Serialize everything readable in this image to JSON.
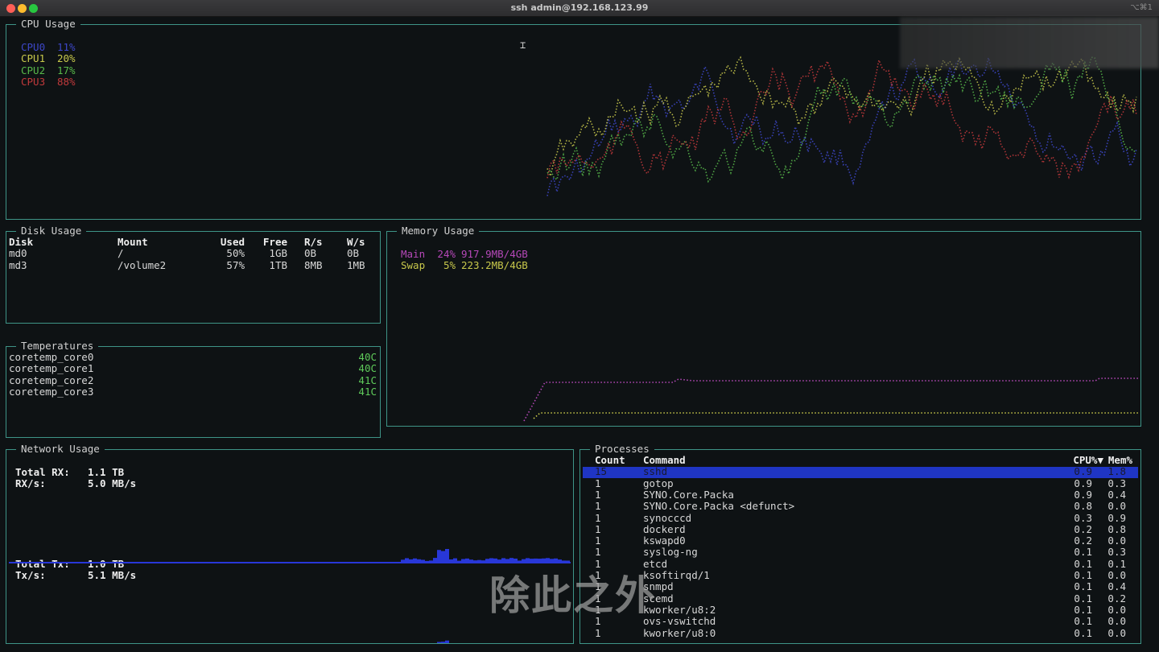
{
  "window": {
    "title": "ssh admin@192.168.123.99",
    "shortcut": "⌥⌘1"
  },
  "colors": {
    "border": "#3e9487",
    "cpu0": "#3d47c8",
    "cpu1": "#c8c84b",
    "cpu2": "#58b84a",
    "cpu3": "#c0393b",
    "mem_main": "#b548b8",
    "mem_swap": "#c8c84b",
    "temp": "#5ec95a",
    "net": "#2837d8",
    "selected": "#1f35c4"
  },
  "cpu": {
    "title": "CPU Usage",
    "legend": [
      {
        "name": "CPU0",
        "value": "11%"
      },
      {
        "name": "CPU1",
        "value": "20%"
      },
      {
        "name": "CPU2",
        "value": "17%"
      },
      {
        "name": "CPU3",
        "value": "88%"
      }
    ]
  },
  "disk": {
    "title": "Disk Usage",
    "headers": [
      "Disk",
      "Mount",
      "Used",
      "Free",
      "R/s",
      "W/s"
    ],
    "rows": [
      [
        "md0",
        "/",
        "50%",
        "1GB",
        "0B",
        "0B"
      ],
      [
        "md3",
        "/volume2",
        "57%",
        "1TB",
        "8MB",
        "1MB"
      ]
    ]
  },
  "memory": {
    "title": "Memory Usage",
    "rows": [
      {
        "label": "Main",
        "percent": "24%",
        "detail": "917.9MB/4GB"
      },
      {
        "label": "Swap",
        "percent": "5%",
        "detail": "223.2MB/4GB"
      }
    ]
  },
  "temps": {
    "title": "Temperatures",
    "rows": [
      {
        "name": "coretemp_core0",
        "value": "40C"
      },
      {
        "name": "coretemp_core1",
        "value": "40C"
      },
      {
        "name": "coretemp_core2",
        "value": "41C"
      },
      {
        "name": "coretemp_core3",
        "value": "41C"
      }
    ]
  },
  "network": {
    "title": "Network Usage",
    "rx": {
      "total_label": "Total RX:",
      "total": "1.1 TB",
      "rate_label": "RX/s:",
      "rate": "5.0 MB/s"
    },
    "tx": {
      "total_label": "Total Tx:",
      "total": "1.0 TB",
      "rate_label": "Tx/s:",
      "rate": "5.1 MB/s"
    }
  },
  "processes": {
    "title": "Processes",
    "headers": {
      "count": "Count",
      "command": "Command",
      "cpu": "CPU%▼",
      "mem": "Mem%"
    },
    "rows": [
      [
        "15",
        "sshd",
        "0.9",
        "1.8"
      ],
      [
        "1",
        "gotop",
        "0.9",
        "0.3"
      ],
      [
        "1",
        "SYNO.Core.Packa",
        "0.9",
        "0.4"
      ],
      [
        "1",
        "SYNO.Core.Packa <defunct>",
        "0.8",
        "0.0"
      ],
      [
        "1",
        "synocccd",
        "0.3",
        "0.9"
      ],
      [
        "1",
        "dockerd",
        "0.2",
        "0.8"
      ],
      [
        "1",
        "kswapd0",
        "0.2",
        "0.0"
      ],
      [
        "1",
        "syslog-ng",
        "0.1",
        "0.3"
      ],
      [
        "1",
        "etcd",
        "0.1",
        "0.1"
      ],
      [
        "1",
        "ksoftirqd/1",
        "0.1",
        "0.0"
      ],
      [
        "1",
        "snmpd",
        "0.1",
        "0.4"
      ],
      [
        "1",
        "scemd",
        "0.1",
        "0.2"
      ],
      [
        "1",
        "kworker/u8:2",
        "0.1",
        "0.0"
      ],
      [
        "1",
        "ovs-vswitchd",
        "0.1",
        "0.0"
      ],
      [
        "1",
        "kworker/u8:0",
        "0.1",
        "0.0"
      ]
    ]
  },
  "subtitle": "除此之外"
}
